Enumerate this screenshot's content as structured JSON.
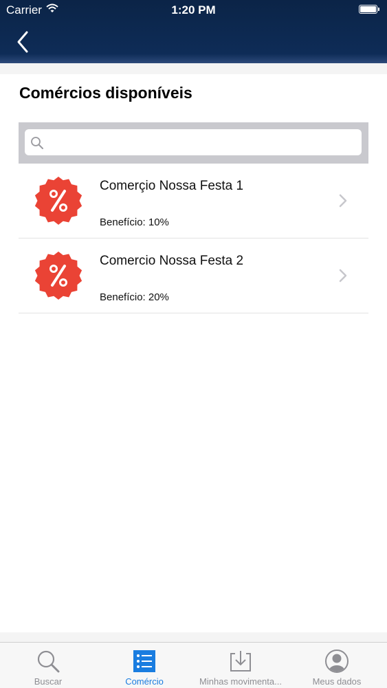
{
  "status_bar": {
    "carrier": "Carrier",
    "time": "1:20 PM"
  },
  "nav": {
    "back_icon": "chevron-left-icon"
  },
  "page": {
    "title": "Comércios disponíveis"
  },
  "search": {
    "placeholder": "",
    "value": ""
  },
  "merchants": [
    {
      "name": "Comerçio Nossa Festa 1",
      "benefit": "Benefício: 10%",
      "icon": "discount-badge-icon"
    },
    {
      "name": "Comercio Nossa Festa 2",
      "benefit": "Benefício: 20%",
      "icon": "discount-badge-icon"
    }
  ],
  "tabs": [
    {
      "label": "Buscar",
      "icon": "search-icon",
      "active": false
    },
    {
      "label": "Comércio",
      "icon": "list-icon",
      "active": true
    },
    {
      "label": "Minhas movimenta...",
      "icon": "download-icon",
      "active": false
    },
    {
      "label": "Meus dados",
      "icon": "user-icon",
      "active": false
    }
  ],
  "colors": {
    "nav_bar": "#0e2c57",
    "accent": "#1a7de0",
    "badge": "#ea4335",
    "tab_inactive": "#8e8e93"
  }
}
